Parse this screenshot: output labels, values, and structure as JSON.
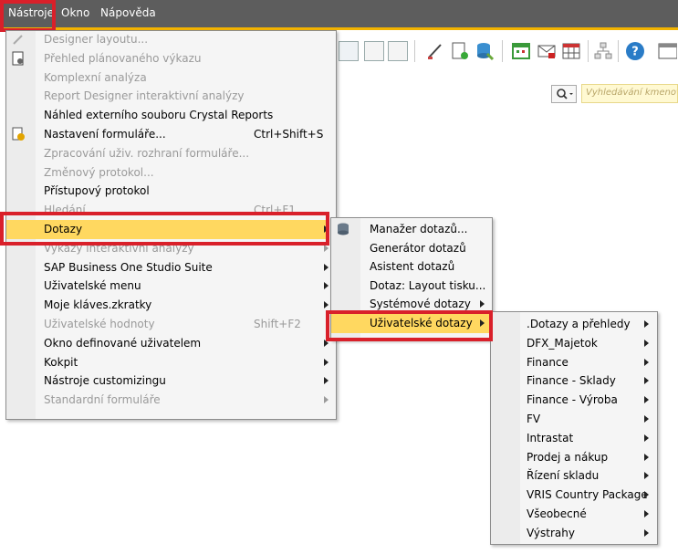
{
  "menubar": {
    "items": [
      {
        "label": "Nástroje"
      },
      {
        "label": "Okno"
      },
      {
        "label": "Nápověda"
      }
    ]
  },
  "search": {
    "placeholder": "Vyhledávání kmenových"
  },
  "tools_menu": {
    "items": [
      {
        "label": "Designer layoutu...",
        "enabled": false,
        "icon": "pencil-icon"
      },
      {
        "label": "Přehled plánovaného výkazu",
        "enabled": false,
        "icon": "report-icon"
      },
      {
        "label": "Komplexní analýza",
        "enabled": false
      },
      {
        "label": "Report Designer interaktivní analýzy",
        "enabled": false
      },
      {
        "label": "Náhled externího souboru Crystal Reports",
        "enabled": true
      },
      {
        "label": "Nastavení formuláře...",
        "shortcut": "Ctrl+Shift+S",
        "enabled": true,
        "icon": "form-settings-icon"
      },
      {
        "label": "Zpracování uživ. rozhraní formuláře...",
        "enabled": false
      },
      {
        "label": "Změnový protokol...",
        "enabled": false
      },
      {
        "label": "Přístupový protokol",
        "enabled": true
      },
      {
        "label": "Hledání",
        "shortcut": "Ctrl+F1",
        "enabled": false
      },
      {
        "label": "Dotazy",
        "enabled": true,
        "submenu": true,
        "selected": true
      },
      {
        "label": "Výkazy interaktivní analýzy",
        "enabled": false,
        "submenu": true
      },
      {
        "label": "SAP Business One Studio Suite",
        "enabled": true,
        "submenu": true
      },
      {
        "label": "Uživatelské menu",
        "enabled": true,
        "submenu": true
      },
      {
        "label": "Moje kláves.zkratky",
        "enabled": true,
        "submenu": true
      },
      {
        "label": "Uživatelské hodnoty",
        "shortcut": "Shift+F2",
        "enabled": false
      },
      {
        "label": "Okno definované uživatelem",
        "enabled": true,
        "submenu": true
      },
      {
        "label": "Kokpit",
        "enabled": true,
        "submenu": true
      },
      {
        "label": "Nástroje customizingu",
        "enabled": true,
        "submenu": true
      },
      {
        "label": "Standardní formuláře",
        "enabled": false,
        "submenu": true
      }
    ]
  },
  "queries_menu": {
    "items": [
      {
        "label": "Manažer dotazů...",
        "enabled": true,
        "icon": "query-manager-icon"
      },
      {
        "label": "Generátor dotazů",
        "enabled": true
      },
      {
        "label": "Asistent dotazů",
        "enabled": true
      },
      {
        "label": "Dotaz: Layout tisku...",
        "enabled": true
      },
      {
        "label": "Systémové dotazy",
        "enabled": true,
        "submenu": true
      },
      {
        "label": "Uživatelské dotazy",
        "enabled": true,
        "submenu": true,
        "selected": true
      }
    ]
  },
  "user_queries_menu": {
    "items": [
      {
        "label": ".Dotazy a přehledy"
      },
      {
        "label": "DFX_Majetok"
      },
      {
        "label": "Finance"
      },
      {
        "label": "Finance - Sklady"
      },
      {
        "label": "Finance - Výroba"
      },
      {
        "label": "FV"
      },
      {
        "label": "Intrastat"
      },
      {
        "label": "Prodej a nákup"
      },
      {
        "label": "Řízení skladu"
      },
      {
        "label": "VRIS Country Package"
      },
      {
        "label": "Všeobecné"
      },
      {
        "label": "Výstrahy"
      }
    ]
  },
  "colors": {
    "highlight": "#ffd860",
    "callout": "#d9202a",
    "menubar": "#5d5d5d",
    "accent": "#f2b300"
  }
}
